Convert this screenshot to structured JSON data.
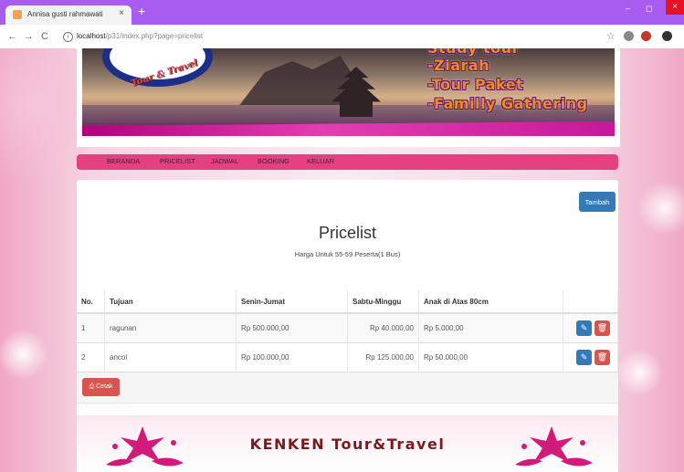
{
  "browser": {
    "tab_title": "Annisa gusti rahmawati",
    "tab_close": "×",
    "new_tab": "+",
    "url_host": "localhost",
    "url_path": "/p31/index.php?page=pricelist",
    "window_controls": {
      "minimize": "‒",
      "maximize": "◻",
      "close": "×"
    },
    "nav_icons": {
      "back": "←",
      "forward": "→",
      "reload": "C",
      "info": "i",
      "bookmark": "☆"
    }
  },
  "banner": {
    "logo_text": "Tour & Travel",
    "lines": [
      "Study tour",
      "-Ziarah",
      "-Tour Paket",
      "-Familly Gathering"
    ]
  },
  "navbar": {
    "items": [
      "BERANDA",
      "PRICELIST",
      "JADWAL",
      "BOOKING",
      "KELUAR"
    ]
  },
  "content": {
    "add_button": "Tambah",
    "title": "Pricelist",
    "subtitle": "Harga Untuk 55-59 Peserta(1 Bus)",
    "table": {
      "headers": [
        "No.",
        "Tujuan",
        "Senin-Jumat",
        "Sabtu-Minggu",
        "Anak di Atas 80cm",
        ""
      ],
      "rows": [
        {
          "no": "1",
          "tujuan": "ragunan",
          "senin_jumat": "Rp 500.000,00",
          "sabtu_minggu": "Rp 40.000,00",
          "anak": "Rp 5.000,00"
        },
        {
          "no": "2",
          "tujuan": "ancol",
          "senin_jumat": "Rp 100.000,00",
          "sabtu_minggu": "Rp 125.000,00",
          "anak": "Rp 50.000,00"
        }
      ],
      "edit_icon": "✎",
      "delete_icon": "🗑"
    },
    "print_button": "Cetak",
    "print_icon": "⎙"
  },
  "footer": {
    "text": "KENKEN Tour&Travel"
  },
  "colors": {
    "browser_bar": "#a85df0",
    "navbar": "#e5407f",
    "primary_button": "#337ab7",
    "danger_button": "#d9534f",
    "footer_text": "#7b1a1a"
  }
}
